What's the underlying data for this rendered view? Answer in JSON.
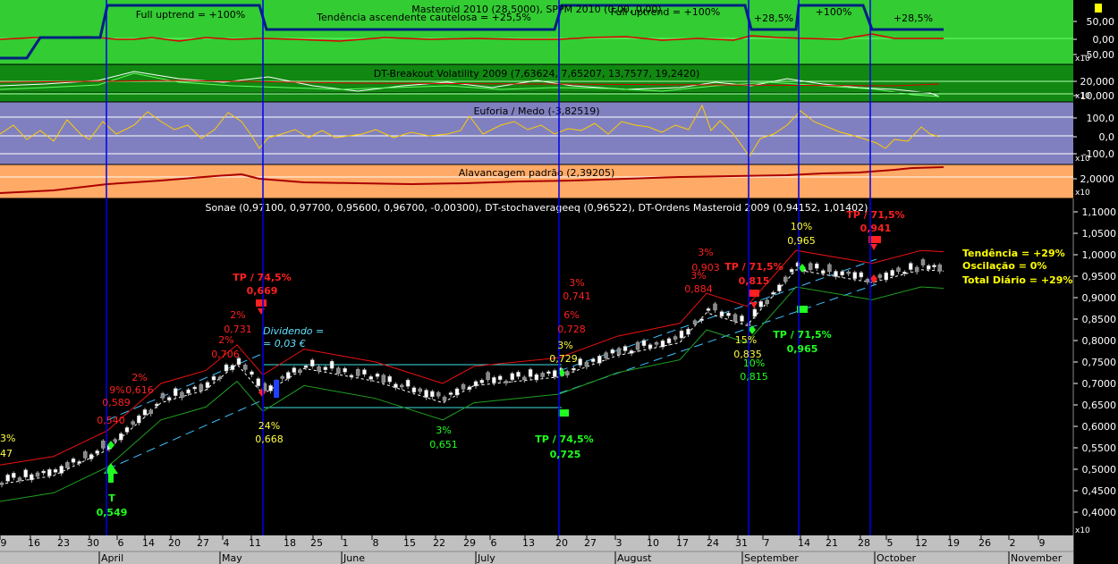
{
  "colors": {
    "panel1_bg": "#33cc33",
    "panel2_bg": "#118811",
    "panel3_bg": "#8080c0",
    "panel4_bg": "#ffaa66",
    "main_bg": "#000000",
    "axis_bg": "#c0c0c0",
    "signal_line": "#0000ee",
    "tp_red": "#ff2020",
    "tp_green": "#20ff20",
    "label_yellow": "#ffff40",
    "label_red": "#ff2020",
    "summary_yellow": "#ffff00"
  },
  "panel1": {
    "title": "Masteroid 2010 (28,5000), SPPM 2010 (0,00, 0,00)",
    "labels": [
      "Full uptrend = +100%",
      "Tendência ascendente cautelosa = +25,5%",
      "Full uptrend = +100%",
      "+28,5%",
      "+100%",
      "+28,5%"
    ],
    "y_ticks": [
      "50,00",
      "0,00",
      "-50,00"
    ],
    "scale_tag": "x10"
  },
  "panel2": {
    "title": "DT-Breakout Volatility 2009 (7,63624, 7,65207, 13,7577, 19,2420)",
    "y_ticks": [
      "20,000",
      "10,000"
    ],
    "scale_tag": "x10"
  },
  "panel3": {
    "title": "Euforia / Medo (-3,82519)",
    "y_ticks": [
      "100,0",
      "0,0",
      "-100,0"
    ],
    "scale_tag": "x10"
  },
  "panel4": {
    "title": "Alavancagem padrão (2,39205)",
    "y_ticks": [
      "2,0000"
    ],
    "scale_tag": "x10"
  },
  "main": {
    "title": "Sonae (0,97100, 0,97700, 0,95600, 0,96700, -0,00300), DT-stochaverageeq (0,96522), DT-Ordens Masteroid 2009 (0,94152, 1,01402)",
    "y_ticks": [
      "1,1000",
      "1,0500",
      "1,0000",
      "0,9500",
      "0,9000",
      "0,8500",
      "0,8000",
      "0,7500",
      "0,7000",
      "0,6500",
      "0,6000",
      "0,5500",
      "0,5000",
      "0,4500",
      "0,4000"
    ],
    "scale_tag": "x10",
    "summary": [
      "Tendência = +29%",
      "Oscilação = 0%",
      "Total Diário = +29%"
    ],
    "dividend_label": [
      "Dividendo =",
      "= 0,03 €"
    ]
  },
  "x_axis": {
    "day_ticks": [
      "9",
      "16",
      "23",
      "30",
      "6",
      "14",
      "20",
      "27",
      "4",
      "11",
      "18",
      "25",
      "1",
      "8",
      "15",
      "22",
      "29",
      "6",
      "13",
      "20",
      "27",
      "3",
      "10",
      "17",
      "24",
      "31",
      "7",
      "14",
      "21",
      "28",
      "5",
      "12",
      "19",
      "26",
      "2",
      "9"
    ],
    "months": [
      "April",
      "May",
      "June",
      "July",
      "August",
      "September",
      "October",
      "November"
    ],
    "scale_tag": "x10"
  },
  "annotations": [
    {
      "text": "3%",
      "color": "yellow"
    },
    {
      "text": "47",
      "color": "yellow"
    },
    {
      "text": "T",
      "color": "green"
    },
    {
      "text": "0,549",
      "color": "green"
    },
    {
      "text": "9%",
      "color": "red"
    },
    {
      "text": "0,589",
      "color": "red"
    },
    {
      "text": "0,540",
      "color": "red"
    },
    {
      "text": "2%",
      "color": "red"
    },
    {
      "text": "0,616",
      "color": "red"
    },
    {
      "text": "2%",
      "color": "red"
    },
    {
      "text": "0,731",
      "color": "red"
    },
    {
      "text": "2%",
      "color": "red"
    },
    {
      "text": "0,706",
      "color": "red"
    },
    {
      "text": "TP / 74,5%",
      "color": "red"
    },
    {
      "text": "0,669",
      "color": "red"
    },
    {
      "text": "24%",
      "color": "yellow"
    },
    {
      "text": "0,668",
      "color": "yellow"
    },
    {
      "text": "3%",
      "color": "green"
    },
    {
      "text": "0,651",
      "color": "green"
    },
    {
      "text": "3%",
      "color": "red"
    },
    {
      "text": "0,741",
      "color": "red"
    },
    {
      "text": "6%",
      "color": "red"
    },
    {
      "text": "0,728",
      "color": "red"
    },
    {
      "text": "3%",
      "color": "yellow"
    },
    {
      "text": "0,729",
      "color": "yellow"
    },
    {
      "text": "TP / 74,5%",
      "color": "green"
    },
    {
      "text": "0,725",
      "color": "green"
    },
    {
      "text": "3%",
      "color": "red"
    },
    {
      "text": "0,903",
      "color": "red"
    },
    {
      "text": "3%",
      "color": "red"
    },
    {
      "text": "0,884",
      "color": "red"
    },
    {
      "text": "TP / 71,5%",
      "color": "red"
    },
    {
      "text": "0,815",
      "color": "red"
    },
    {
      "text": "15%",
      "color": "yellow"
    },
    {
      "text": "0,835",
      "color": "yellow"
    },
    {
      "text": "10%",
      "color": "green"
    },
    {
      "text": "0,815",
      "color": "green"
    },
    {
      "text": "10%",
      "color": "yellow"
    },
    {
      "text": "0,965",
      "color": "yellow"
    },
    {
      "text": "TP / 71,5%",
      "color": "green"
    },
    {
      "text": "0,965",
      "color": "green"
    },
    {
      "text": "TP / 71,5%",
      "color": "red"
    },
    {
      "text": "0,941",
      "color": "red"
    }
  ],
  "chart_data": {
    "type": "candlestick",
    "title": "Sonae (0,97100, 0,97700, 0,95600, 0,96700, -0,00300), DT-stochaverageeq (0,96522), DT-Ordens Masteroid 2009 (0,94152, 1,01402)",
    "ylim": [
      0.38,
      1.11
    ],
    "last_ohlc": {
      "open": 0.971,
      "high": 0.977,
      "low": 0.956,
      "close": 0.967,
      "change": -0.003
    },
    "stochaverageeq": 0.96522,
    "ordens_masteroid": [
      0.94152,
      1.01402
    ],
    "close_path_approx": [
      {
        "date": "Mar 9",
        "close": 0.47
      },
      {
        "date": "Mar 23",
        "close": 0.49
      },
      {
        "date": "Apr 1",
        "close": 0.55
      },
      {
        "date": "Apr 14",
        "close": 0.66
      },
      {
        "date": "Apr 27",
        "close": 0.69
      },
      {
        "date": "May 6",
        "close": 0.75
      },
      {
        "date": "May 11",
        "close": 0.68
      },
      {
        "date": "May 25",
        "close": 0.74
      },
      {
        "date": "Jun 15",
        "close": 0.71
      },
      {
        "date": "Jun 29",
        "close": 0.66
      },
      {
        "date": "Jul 6",
        "close": 0.7
      },
      {
        "date": "Jul 20",
        "close": 0.72
      },
      {
        "date": "Aug 3",
        "close": 0.77
      },
      {
        "date": "Aug 17",
        "close": 0.8
      },
      {
        "date": "Aug 24",
        "close": 0.87
      },
      {
        "date": "Sep 2",
        "close": 0.84
      },
      {
        "date": "Sep 14",
        "close": 0.97
      },
      {
        "date": "Sep 28",
        "close": 0.94
      },
      {
        "date": "Oct 12",
        "close": 0.97
      },
      {
        "date": "Oct 16",
        "close": 0.967
      }
    ]
  }
}
